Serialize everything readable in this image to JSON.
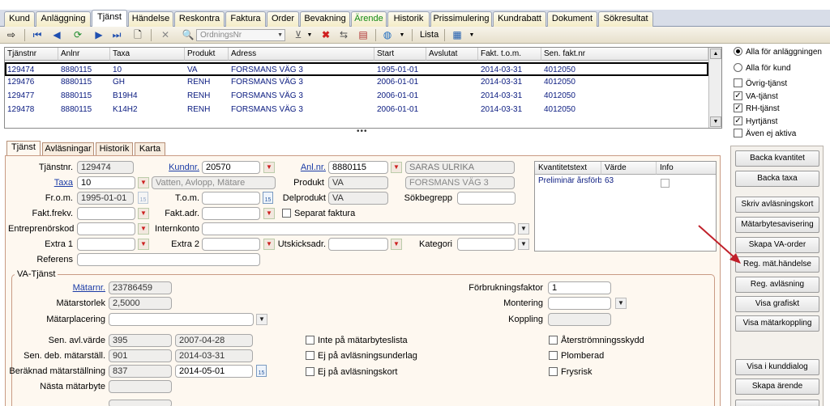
{
  "main_tabs": [
    {
      "label": "Kund",
      "active": false,
      "green": false
    },
    {
      "label": "Anläggning",
      "active": false,
      "green": false
    },
    {
      "label": "Tjänst",
      "active": true,
      "green": false
    },
    {
      "label": "Händelse",
      "active": false,
      "green": false
    },
    {
      "label": "Reskontra",
      "active": false,
      "green": false
    },
    {
      "label": "Faktura",
      "active": false,
      "green": false
    },
    {
      "label": "Order",
      "active": false,
      "green": false
    },
    {
      "label": "Bevakning",
      "active": false,
      "green": false
    },
    {
      "label": "Ärende",
      "active": false,
      "green": true
    },
    {
      "label": "Historik",
      "active": false,
      "green": false
    },
    {
      "label": "Prissimulering",
      "active": false,
      "green": false
    },
    {
      "label": "Kundrabatt",
      "active": false,
      "green": false
    },
    {
      "label": "Dokument",
      "active": false,
      "green": false
    },
    {
      "label": "Sökresultat",
      "active": false,
      "green": false
    }
  ],
  "toolbar": {
    "sort_placeholder": "OrdningsNr",
    "lista_label": "Lista",
    "icons": [
      "pointer-icon",
      "first-record-icon",
      "previous-record-icon",
      "refresh-icon",
      "next-record-icon",
      "last-record-icon",
      "new-record-icon",
      "delete-icon",
      "find-icon",
      "filter-icon",
      "clear-filter-icon",
      "transfer-icon",
      "chart-icon",
      "globe-icon",
      "export-icon"
    ]
  },
  "grid": {
    "columns": [
      "Tjänstnr",
      "Anlnr",
      "Taxa",
      "Produkt",
      "Adress",
      "Start",
      "Avslutat",
      "Fakt. t.o.m.",
      "Sen. fakt.nr"
    ],
    "rows": [
      {
        "selected": true,
        "cells": [
          "129474",
          "8880115",
          "10",
          "VA",
          "FORSMANS VÄG 3",
          "1995-01-01",
          "",
          "2014-03-31",
          "4012050"
        ]
      },
      {
        "selected": false,
        "cells": [
          "129476",
          "8880115",
          "GH",
          "RENH",
          "FORSMANS VÄG 3",
          "2006-01-01",
          "",
          "2014-03-31",
          "4012050"
        ]
      },
      {
        "selected": false,
        "cells": [
          "129477",
          "8880115",
          "B19H4",
          "RENH",
          "FORSMANS VÄG 3",
          "2006-01-01",
          "",
          "2014-03-31",
          "4012050"
        ]
      },
      {
        "selected": false,
        "cells": [
          "129478",
          "8880115",
          "K14H2",
          "RENH",
          "FORSMANS VÄG 3",
          "2006-01-01",
          "",
          "2014-03-31",
          "4012050"
        ]
      }
    ]
  },
  "filter": {
    "radio_all_anl": "Alla för anläggningen",
    "radio_all_kund": "Alla för kund",
    "checks": [
      {
        "label": "Övrig-tjänst",
        "checked": false
      },
      {
        "label": "VA-tjänst",
        "checked": true
      },
      {
        "label": "RH-tjänst",
        "checked": true
      },
      {
        "label": "Hyrtjänst",
        "checked": true
      },
      {
        "label": "Även ej aktiva",
        "checked": false
      }
    ]
  },
  "sub_tabs": [
    "Tjänst",
    "Avläsningar",
    "Historik",
    "Karta"
  ],
  "form": {
    "tjanstnr_label": "Tjänstnr.",
    "tjanstnr": "129474",
    "kundnr_label": "Kundnr.",
    "kundnr": "20570",
    "anlnr_label": "Anl.nr.",
    "anlnr": "8880115",
    "kund_namn": "SARAS ULRIKA",
    "taxa_label": "Taxa",
    "taxa": "10",
    "taxa_desc": "Vatten, Avlopp, Mätare",
    "produkt_label": "Produkt",
    "produkt": "VA",
    "adress": "FORSMANS VÄG 3",
    "from_label": "Fr.o.m.",
    "from": "1995-01-01",
    "tom_label": "T.o.m.",
    "delprodukt_label": "Delprodukt",
    "delprodukt": "VA",
    "sokbegrepp_label": "Sökbegrepp",
    "faktfrekv_label": "Fakt.frekv.",
    "faktadr_label": "Fakt.adr.",
    "separat_label": "Separat faktura",
    "entreprenor_label": "Entreprenörskod",
    "internkonto_label": "Internkonto",
    "extra1_label": "Extra 1",
    "extra2_label": "Extra 2",
    "utskick_label": "Utskicksadr.",
    "kategori_label": "Kategori",
    "referens_label": "Referens"
  },
  "quantity": {
    "columns": [
      "Kvantitetstext",
      "Värde",
      "Info"
    ],
    "rows": [
      {
        "text": "Preliminär årsförb",
        "value": "63",
        "info": false
      }
    ]
  },
  "va": {
    "legend": "VA-Tjänst",
    "matarnr_label": "Mätarnr.",
    "matarnr": "23786459",
    "matarstorlek_label": "Mätarstorlek",
    "matarstorlek": "2,5000",
    "matarplacering_label": "Mätarplacering",
    "sen_avl_label": "Sen. avl.värde",
    "sen_avl": "395",
    "sen_avl_datum": "2007-04-28",
    "sen_deb_label": "Sen. deb. mätarställ.",
    "sen_deb": "901",
    "sen_deb_datum": "2014-03-31",
    "berakn_label": "Beräknad mätarställning",
    "berakn": "837",
    "berakn_datum": "2014-05-01",
    "nasta_label": "Nästa mätarbyte",
    "forbruk_label": "Förbrukningsfaktor",
    "forbruk": "1",
    "montering_label": "Montering",
    "koppling_label": "Koppling",
    "checks_mid": [
      "Inte på mätarbyteslista",
      "Ej på avläsningsunderlag",
      "Ej på avläsningskort"
    ],
    "checks_right": [
      "Återströmningsskydd",
      "Plomberad",
      "Frysrisk"
    ]
  },
  "buttons": [
    "Backa kvantitet",
    "Backa taxa",
    "Skriv avläsningskort",
    "Mätarbytesavisering",
    "Skapa VA-order",
    "Reg. mät.händelse",
    "Reg. avläsning",
    "Visa grafiskt",
    "Visa mätarkoppling",
    "Visa i kunddialog",
    "Skapa ärende"
  ],
  "colors": {
    "link": "#1a3ba6",
    "grid_text": "#0a1b80",
    "arrow": "#c0202a",
    "form_bg": "#fef8f0"
  }
}
